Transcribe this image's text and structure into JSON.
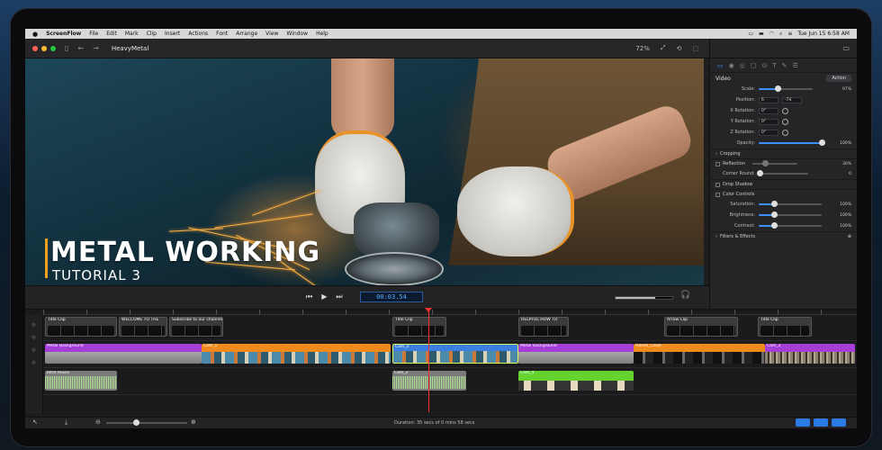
{
  "menubar": {
    "app": "ScreenFlow",
    "items": [
      "File",
      "Edit",
      "Mark",
      "Clip",
      "Insert",
      "Actions",
      "Font",
      "Arrange",
      "View",
      "Window",
      "Help"
    ],
    "clock": "Tue Jun 15  6:58 AM"
  },
  "toolbar": {
    "doc_title": "HeavyMetal",
    "zoom": "72%"
  },
  "canvas": {
    "title_main": "METAL WORKING",
    "title_sub": "TUTORIAL 3"
  },
  "inspector": {
    "section": "Video",
    "action_label": "Action",
    "rows": {
      "scale_label": "Scale:",
      "scale_value": "97%",
      "position_label": "Position:",
      "position_x": "6",
      "position_y": "-74",
      "xrot_label": "X Rotation:",
      "xrot_value": "0°",
      "yrot_label": "Y Rotation:",
      "yrot_value": "0°",
      "zrot_label": "Z Rotation:",
      "zrot_value": "0°",
      "opacity_label": "Opacity:",
      "opacity_value": "100%"
    },
    "cropping_label": "Cropping",
    "reflection_label": "Reflection",
    "reflection_value": "30%",
    "corner_label": "Corner Round:",
    "corner_value": "0",
    "drop_shadow_label": "Drop Shadow",
    "color_controls_label": "Color Controls",
    "saturation_label": "Saturation:",
    "saturation_value": "100%",
    "brightness_label": "Brightness:",
    "brightness_value": "100%",
    "contrast_label": "Contrast:",
    "contrast_value": "100%",
    "filters_label": "Filters & Effects",
    "levels": {
      "scale": 0.35,
      "opacity": 1.0,
      "reflection": 0.3,
      "saturation": 0.25,
      "brightness": 0.25,
      "contrast": 0.25
    }
  },
  "transport": {
    "timecode": "00:03.54",
    "volume_level": 0.7
  },
  "timeline": {
    "text_clips": [
      {
        "label": "Title Clip"
      },
      {
        "label": "WELCOME TO THE"
      },
      {
        "label": "Subscribe to our channel"
      },
      {
        "label": "Title Clip"
      },
      {
        "label": "HELPFUL HOW TO"
      },
      {
        "label": "Arrow Clip"
      },
      {
        "label": "Title Clip"
      }
    ],
    "video_clips": [
      {
        "label": "Metal Background"
      },
      {
        "label": "Cam_1"
      },
      {
        "label": "Cam_2"
      },
      {
        "label": "Metal Background"
      },
      {
        "label": "Hands_Close"
      },
      {
        "label": "Cam_3"
      }
    ],
    "audio_clips": [
      {
        "label": "Intro music"
      },
      {
        "label": "Cam_2"
      },
      {
        "label": "Cam_4"
      }
    ]
  },
  "status": {
    "duration": "Duration: 35 secs of 0 mins 58 secs"
  }
}
